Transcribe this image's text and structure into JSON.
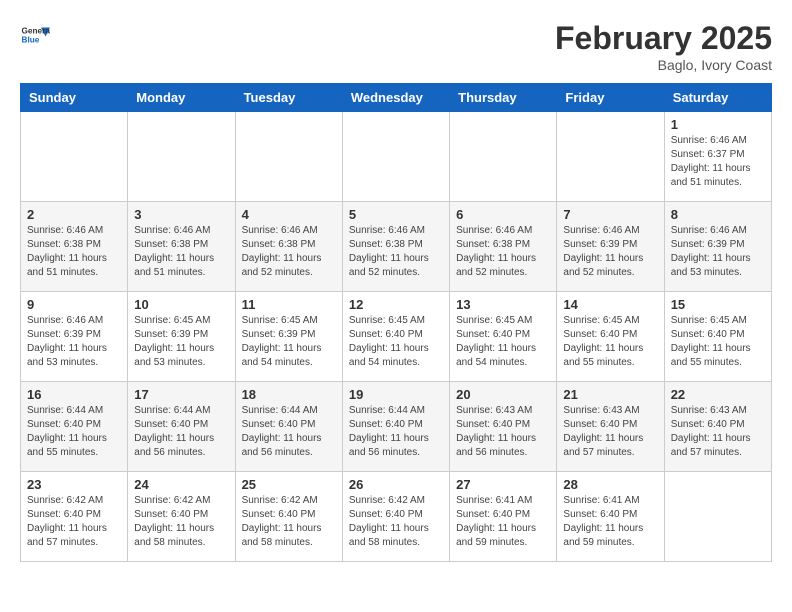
{
  "logo": {
    "general": "General",
    "blue": "Blue"
  },
  "header": {
    "month": "February 2025",
    "location": "Baglo, Ivory Coast"
  },
  "weekdays": [
    "Sunday",
    "Monday",
    "Tuesday",
    "Wednesday",
    "Thursday",
    "Friday",
    "Saturday"
  ],
  "weeks": [
    [
      {
        "day": "",
        "info": ""
      },
      {
        "day": "",
        "info": ""
      },
      {
        "day": "",
        "info": ""
      },
      {
        "day": "",
        "info": ""
      },
      {
        "day": "",
        "info": ""
      },
      {
        "day": "",
        "info": ""
      },
      {
        "day": "1",
        "info": "Sunrise: 6:46 AM\nSunset: 6:37 PM\nDaylight: 11 hours and 51 minutes."
      }
    ],
    [
      {
        "day": "2",
        "info": "Sunrise: 6:46 AM\nSunset: 6:38 PM\nDaylight: 11 hours and 51 minutes."
      },
      {
        "day": "3",
        "info": "Sunrise: 6:46 AM\nSunset: 6:38 PM\nDaylight: 11 hours and 51 minutes."
      },
      {
        "day": "4",
        "info": "Sunrise: 6:46 AM\nSunset: 6:38 PM\nDaylight: 11 hours and 52 minutes."
      },
      {
        "day": "5",
        "info": "Sunrise: 6:46 AM\nSunset: 6:38 PM\nDaylight: 11 hours and 52 minutes."
      },
      {
        "day": "6",
        "info": "Sunrise: 6:46 AM\nSunset: 6:38 PM\nDaylight: 11 hours and 52 minutes."
      },
      {
        "day": "7",
        "info": "Sunrise: 6:46 AM\nSunset: 6:39 PM\nDaylight: 11 hours and 52 minutes."
      },
      {
        "day": "8",
        "info": "Sunrise: 6:46 AM\nSunset: 6:39 PM\nDaylight: 11 hours and 53 minutes."
      }
    ],
    [
      {
        "day": "9",
        "info": "Sunrise: 6:46 AM\nSunset: 6:39 PM\nDaylight: 11 hours and 53 minutes."
      },
      {
        "day": "10",
        "info": "Sunrise: 6:45 AM\nSunset: 6:39 PM\nDaylight: 11 hours and 53 minutes."
      },
      {
        "day": "11",
        "info": "Sunrise: 6:45 AM\nSunset: 6:39 PM\nDaylight: 11 hours and 54 minutes."
      },
      {
        "day": "12",
        "info": "Sunrise: 6:45 AM\nSunset: 6:40 PM\nDaylight: 11 hours and 54 minutes."
      },
      {
        "day": "13",
        "info": "Sunrise: 6:45 AM\nSunset: 6:40 PM\nDaylight: 11 hours and 54 minutes."
      },
      {
        "day": "14",
        "info": "Sunrise: 6:45 AM\nSunset: 6:40 PM\nDaylight: 11 hours and 55 minutes."
      },
      {
        "day": "15",
        "info": "Sunrise: 6:45 AM\nSunset: 6:40 PM\nDaylight: 11 hours and 55 minutes."
      }
    ],
    [
      {
        "day": "16",
        "info": "Sunrise: 6:44 AM\nSunset: 6:40 PM\nDaylight: 11 hours and 55 minutes."
      },
      {
        "day": "17",
        "info": "Sunrise: 6:44 AM\nSunset: 6:40 PM\nDaylight: 11 hours and 56 minutes."
      },
      {
        "day": "18",
        "info": "Sunrise: 6:44 AM\nSunset: 6:40 PM\nDaylight: 11 hours and 56 minutes."
      },
      {
        "day": "19",
        "info": "Sunrise: 6:44 AM\nSunset: 6:40 PM\nDaylight: 11 hours and 56 minutes."
      },
      {
        "day": "20",
        "info": "Sunrise: 6:43 AM\nSunset: 6:40 PM\nDaylight: 11 hours and 56 minutes."
      },
      {
        "day": "21",
        "info": "Sunrise: 6:43 AM\nSunset: 6:40 PM\nDaylight: 11 hours and 57 minutes."
      },
      {
        "day": "22",
        "info": "Sunrise: 6:43 AM\nSunset: 6:40 PM\nDaylight: 11 hours and 57 minutes."
      }
    ],
    [
      {
        "day": "23",
        "info": "Sunrise: 6:42 AM\nSunset: 6:40 PM\nDaylight: 11 hours and 57 minutes."
      },
      {
        "day": "24",
        "info": "Sunrise: 6:42 AM\nSunset: 6:40 PM\nDaylight: 11 hours and 58 minutes."
      },
      {
        "day": "25",
        "info": "Sunrise: 6:42 AM\nSunset: 6:40 PM\nDaylight: 11 hours and 58 minutes."
      },
      {
        "day": "26",
        "info": "Sunrise: 6:42 AM\nSunset: 6:40 PM\nDaylight: 11 hours and 58 minutes."
      },
      {
        "day": "27",
        "info": "Sunrise: 6:41 AM\nSunset: 6:40 PM\nDaylight: 11 hours and 59 minutes."
      },
      {
        "day": "28",
        "info": "Sunrise: 6:41 AM\nSunset: 6:40 PM\nDaylight: 11 hours and 59 minutes."
      },
      {
        "day": "",
        "info": ""
      }
    ]
  ]
}
